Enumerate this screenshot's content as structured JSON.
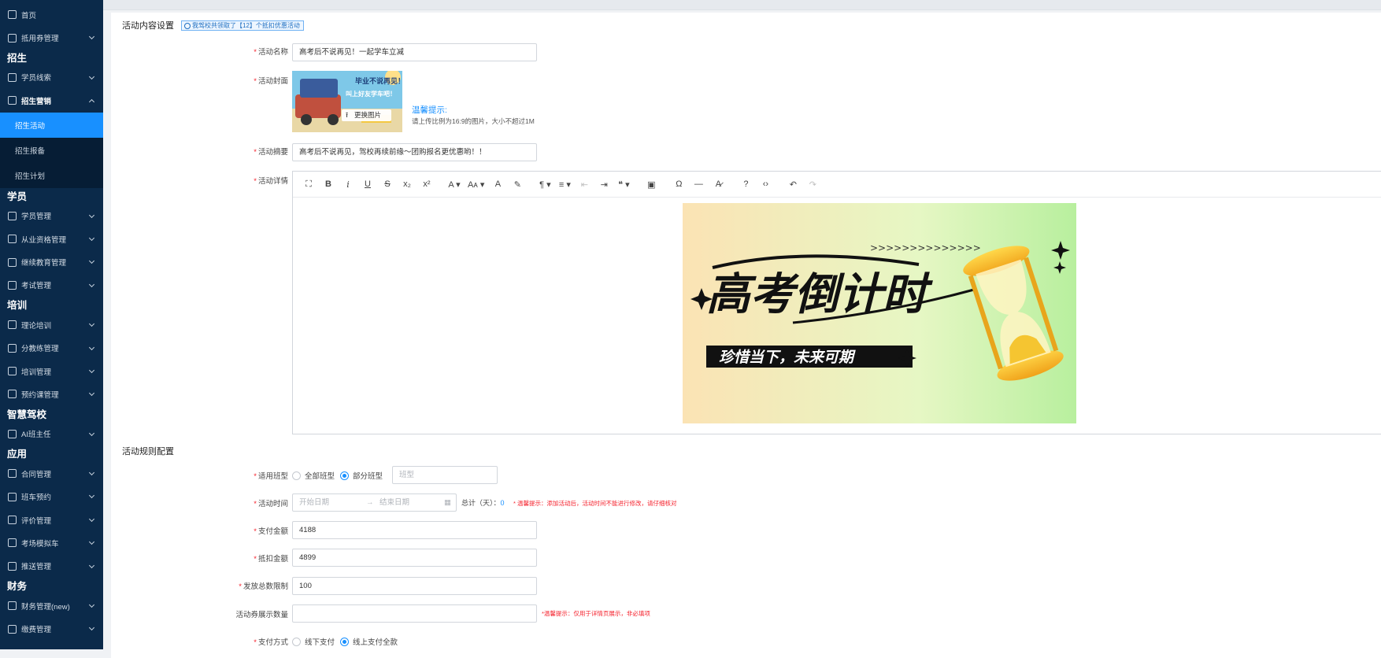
{
  "sidebar": {
    "home": "首页",
    "voucher": "抵用券管理",
    "group_recruit": "招生",
    "student_leads": "学员线索",
    "recruit_marketing": "招生营销",
    "sub_items": [
      "招生活动",
      "招生报备",
      "招生计划"
    ],
    "group_student": "学员",
    "student_mgmt": "学员管理",
    "qualification": "从业资格管理",
    "continuing_edu": "继续教育管理",
    "exam_mgmt": "考试管理",
    "group_training": "培训",
    "theory_training": "理论培训",
    "branch_training": "分教练管理",
    "training_mgmt": "培训管理",
    "booking_mgmt": "预约课管理",
    "group_smart": "智慧驾校",
    "ai_head": "AI班主任",
    "group_app": "应用",
    "contract": "合同管理",
    "shuttle": "班车预约",
    "evaluation": "评价管理",
    "simulator": "考场模拟车",
    "push": "推送管理",
    "group_finance": "财务",
    "finance": "财务管理(new)",
    "last": "缴费管理"
  },
  "section1": {
    "title": "活动内容设置",
    "notice": "我驾校共领取了【12】个抵扣优惠活动"
  },
  "form": {
    "name_label": "活动名称",
    "name_value": "高考后不说再见！一起学车立减",
    "cover_label": "活动封面",
    "replace_btn": "更换图片",
    "cover_text1": "毕业不说再见！",
    "cover_text2": "叫上好友学车吧！",
    "tip_title": "温馨提示:",
    "tip_text": "请上传比例为16:9的图片，大小不超过1M",
    "summary_label": "活动摘要",
    "summary_value": "高考后不说再见，驾校再续前缘～团购报名更优惠哟！！",
    "detail_label": "活动详情"
  },
  "toolbar": [
    "⛶",
    "B",
    "i",
    "U",
    "S",
    "x₂",
    "x²",
    "A ▾",
    "Aᴀ ▾",
    "A",
    "✎",
    "¶ ▾",
    "≡ ▾",
    "⇤",
    "⇥",
    "❝ ▾",
    "▣",
    "Ω",
    "—",
    "A̷",
    "?",
    "‹›",
    "↶",
    "↷"
  ],
  "banner": {
    "arrows": ">>>>>>>>>>>>>>",
    "title": "高考倒计时",
    "subtitle": "珍惜当下，未来可期"
  },
  "section2": {
    "title": "活动规则配置"
  },
  "rules": {
    "class_label": "适用班型",
    "all_class": "全部班型",
    "part_class": "部分班型",
    "class_placeholder": "班型",
    "time_label": "活动时间",
    "start_placeholder": "开始日期",
    "end_placeholder": "结束日期",
    "total_days": "总计（天）：",
    "total_days_value": "0",
    "time_hint": "* 温馨提示：添加活动后，活动时间不能进行修改，请仔细核对",
    "pay_label": "支付金额",
    "pay_value": "4188",
    "deduct_label": "抵扣金额",
    "deduct_value": "4899",
    "limit_label": "发放总数限制",
    "limit_value": "100",
    "display_label": "活动券展示数量",
    "display_hint": "*温馨提示：仅用于详情页展示，非必填项",
    "pay_method_label": "支付方式",
    "offline_pay": "线下支付",
    "online_pay": "线上支付全款"
  },
  "colors": {
    "sidebar_bg": "#0b2a4a",
    "active": "#1890ff",
    "required": "#f5222d"
  }
}
